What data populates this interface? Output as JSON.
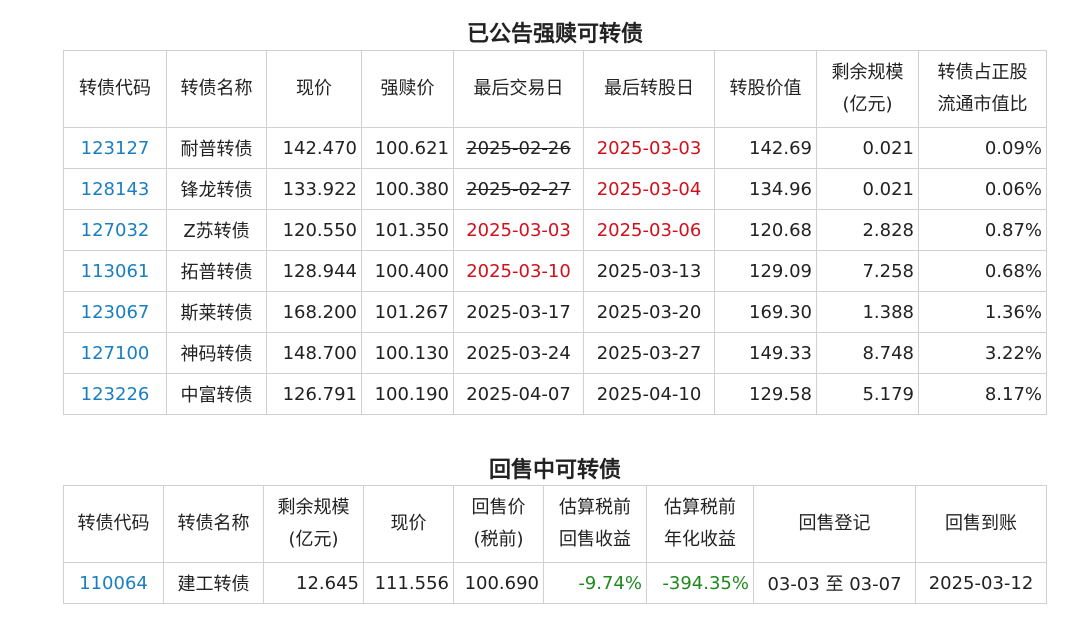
{
  "table1": {
    "title": "已公告强赎可转债",
    "headers": [
      "转债代码",
      "转债名称",
      "现价",
      "强赎价",
      "最后交易日",
      "最后转股日",
      "转股价值",
      "剩余规模\n(亿元)",
      "转债占正股\n流通市值比"
    ],
    "rows": [
      [
        "123127",
        "耐普转债",
        "142.470",
        "100.621",
        "2025-02-26",
        "2025-03-03",
        "142.69",
        "0.021",
        "0.09%"
      ],
      [
        "128143",
        "锋龙转债",
        "133.922",
        "100.380",
        "2025-02-27",
        "2025-03-04",
        "134.96",
        "0.021",
        "0.06%"
      ],
      [
        "127032",
        "Z苏转债",
        "120.550",
        "101.350",
        "2025-03-03",
        "2025-03-06",
        "120.68",
        "2.828",
        "0.87%"
      ],
      [
        "113061",
        "拓普转债",
        "128.944",
        "100.400",
        "2025-03-10",
        "2025-03-13",
        "129.09",
        "7.258",
        "0.68%"
      ],
      [
        "123067",
        "斯莱转债",
        "168.200",
        "101.267",
        "2025-03-17",
        "2025-03-20",
        "169.30",
        "1.388",
        "1.36%"
      ],
      [
        "127100",
        "神码转债",
        "148.700",
        "100.130",
        "2025-03-24",
        "2025-03-27",
        "149.33",
        "8.748",
        "3.22%"
      ],
      [
        "123226",
        "中富转债",
        "126.791",
        "100.190",
        "2025-04-07",
        "2025-04-10",
        "129.58",
        "5.179",
        "8.17%"
      ]
    ],
    "styles": {
      "0": {
        "4": "strike",
        "5": "red"
      },
      "1": {
        "4": "strike",
        "5": "red"
      },
      "2": {
        "4": "red",
        "5": "red"
      },
      "3": {
        "4": "red"
      }
    }
  },
  "table2": {
    "title": "回售中可转债",
    "headers": [
      "转债代码",
      "转债名称",
      "剩余规模\n(亿元)",
      "现价",
      "回售价\n(税前)",
      "估算税前\n回售收益",
      "估算税前\n年化收益",
      "回售登记",
      "回售到账"
    ],
    "rows": [
      [
        "110064",
        "建工转债",
        "12.645",
        "111.556",
        "100.690",
        "-9.74%",
        "-394.35%",
        "03-03 至 03-07",
        "2025-03-12"
      ]
    ],
    "styles": {
      "0": {
        "5": "green",
        "6": "green"
      }
    }
  },
  "colors": {
    "code": "#1a7fc0",
    "red": "#d0111b",
    "green": "#1e8a1e",
    "border": "#d0d0d0"
  }
}
